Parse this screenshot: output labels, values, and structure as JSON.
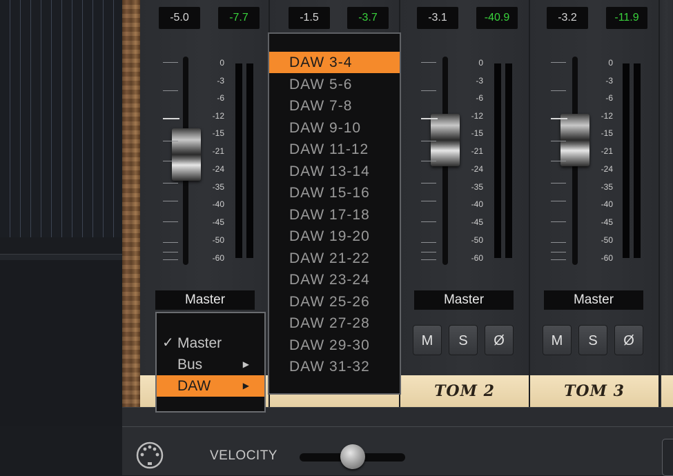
{
  "channels": [
    {
      "volume": "-5.0",
      "peak": "-7.7",
      "output": "Master",
      "name": ""
    },
    {
      "volume": "-1.5",
      "peak": "-3.7",
      "output": "",
      "name": ""
    },
    {
      "volume": "-3.1",
      "peak": "-40.9",
      "output": "Master",
      "name": "TOM 2",
      "buttons": {
        "mute": "M",
        "solo": "S",
        "phase": "Ø"
      }
    },
    {
      "volume": "-3.2",
      "peak": "-11.9",
      "output": "Master",
      "name": "TOM 3",
      "buttons": {
        "mute": "M",
        "solo": "S",
        "phase": "Ø"
      }
    }
  ],
  "scale": [
    "0",
    "-3",
    "-6",
    "-12",
    "-15",
    "-21",
    "-24",
    "-35",
    "-40",
    "-45",
    "-50",
    "-60"
  ],
  "output_menu": {
    "items": [
      {
        "label": "Master",
        "checked": true,
        "submenu": false
      },
      {
        "label": "Bus",
        "checked": false,
        "submenu": true
      },
      {
        "label": "DAW",
        "checked": false,
        "submenu": true,
        "highlighted": true
      }
    ],
    "check_glyph": "✓",
    "arrow_glyph": "▶"
  },
  "daw_submenu": {
    "highlighted_index": 0,
    "items": [
      "DAW 3-4",
      "DAW 5-6",
      "DAW 7-8",
      "DAW 9-10",
      "DAW 11-12",
      "DAW 13-14",
      "DAW 15-16",
      "DAW 17-18",
      "DAW 19-20",
      "DAW 21-22",
      "DAW 23-24",
      "DAW 25-26",
      "DAW 27-28",
      "DAW 29-30",
      "DAW 31-32"
    ]
  },
  "bottom_bar": {
    "velocity_label": "VELOCITY",
    "velocity_value": 0.5,
    "midi_icon": "midi-connector-icon"
  },
  "colors": {
    "highlight": "#f58a2b",
    "peak_text": "#39d23c",
    "name_strip": "#f1ddb2"
  }
}
